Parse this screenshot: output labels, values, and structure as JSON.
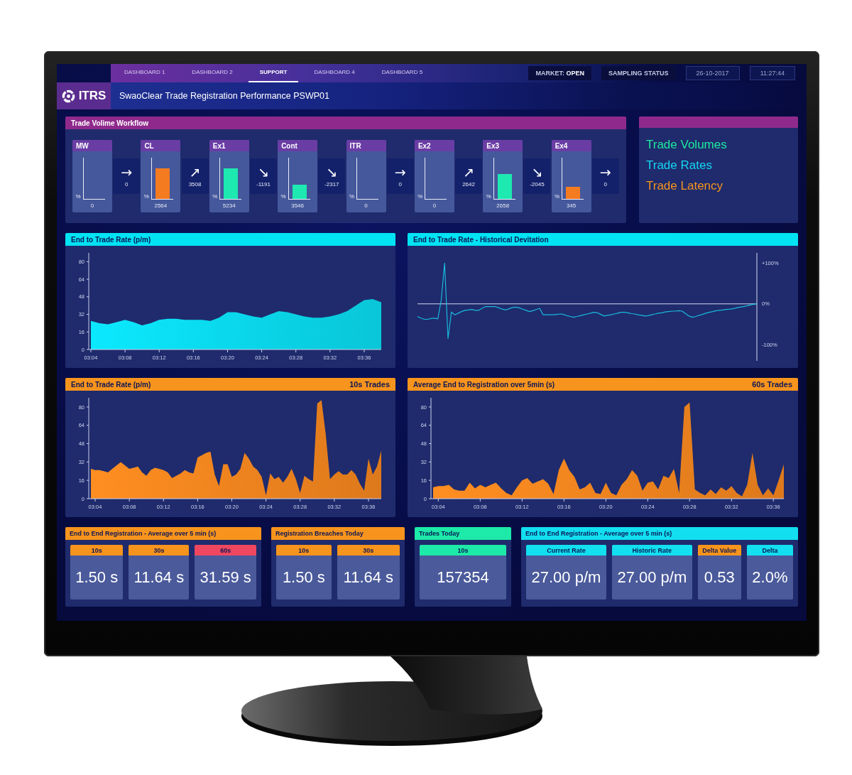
{
  "header": {
    "logo": "ITRS",
    "tabs": [
      {
        "label": "DASHBOARD 1",
        "selected": false
      },
      {
        "label": "DASHBOARD 2",
        "selected": false
      },
      {
        "label": "SUPPORT",
        "selected": true
      },
      {
        "label": "DASHBOARD 4",
        "selected": false
      },
      {
        "label": "DASHBOARD 5",
        "selected": false
      }
    ],
    "title": "SwaoClear Trade Registration Performance PSWP01",
    "status": [
      {
        "kind": "status",
        "text": "MARKET: **OPEN**"
      },
      {
        "kind": "status",
        "text": "SAMPLING STATUS"
      },
      {
        "kind": "readout",
        "text": "26-10-2017"
      },
      {
        "kind": "readout",
        "text": "11:27:44"
      }
    ]
  },
  "workflow": {
    "title": "Trade Volime Workflow",
    "items": [
      {
        "kind": "stage",
        "name": "MW",
        "axis_label": "%",
        "value": "0"
      },
      {
        "kind": "flow",
        "arrow": "→",
        "value": "0"
      },
      {
        "kind": "stage",
        "name": "CL",
        "axis_label": "%",
        "level": 0.75,
        "color": "#f47b20",
        "value": "2564"
      },
      {
        "kind": "flow",
        "arrow": "↗",
        "value": "3508"
      },
      {
        "kind": "stage",
        "name": "Ex1",
        "axis_label": "%",
        "level": 0.75,
        "color": "#1de9b0",
        "value": "5234"
      },
      {
        "kind": "flow",
        "arrow": "↘",
        "value": "-1191"
      },
      {
        "kind": "stage",
        "name": "Cont",
        "axis_label": "%",
        "level": 0.35,
        "color": "#1de9b0",
        "value": "3546"
      },
      {
        "kind": "flow",
        "arrow": "↘",
        "value": "-2317"
      },
      {
        "kind": "stage",
        "name": "ITR",
        "axis_label": "%",
        "value": "0"
      },
      {
        "kind": "flow",
        "arrow": "→",
        "value": "0"
      },
      {
        "kind": "stage",
        "name": "Ex2",
        "axis_label": "%",
        "value": "0"
      },
      {
        "kind": "flow",
        "arrow": "↗",
        "value": "2642"
      },
      {
        "kind": "stage",
        "name": "Ex3",
        "axis_label": "%",
        "level": 0.6,
        "color": "#1de9b0",
        "value": "2658"
      },
      {
        "kind": "flow",
        "arrow": "↘",
        "value": "-2045"
      },
      {
        "kind": "stage",
        "name": "Ex4",
        "axis_label": "%",
        "level": 0.3,
        "color": "#f47b20",
        "value": "345"
      },
      {
        "kind": "flow",
        "arrow": "→",
        "value": "0"
      }
    ]
  },
  "legend": {
    "items": [
      {
        "label": "Trade Volumes",
        "color": "#1de9a0"
      },
      {
        "label": "Trade Rates",
        "color": "#16d6f2"
      },
      {
        "label": "Trade Latency",
        "color": "#f7941d"
      }
    ]
  },
  "charts": [
    {
      "title": "End to Trade Rate (p/m)",
      "color": "#00e3f3",
      "chart_data": {
        "type": "area",
        "categories": [
          "03:04",
          null,
          null,
          null,
          "03:08",
          null,
          null,
          null,
          "03:12",
          null,
          null,
          null,
          "03:16",
          null,
          null,
          null,
          "03:20",
          null,
          null,
          null,
          "03:24",
          null,
          null,
          null,
          "03:28",
          null,
          null,
          null,
          "03:32",
          null,
          null,
          null,
          "03:36",
          null,
          null
        ],
        "series": [
          {
            "color": "#0adcf0",
            "values": [
              26,
              24,
              23,
              25,
              27,
              25,
              22,
              24,
              27,
              28,
              28,
              27,
              27,
              27,
              26,
              29,
              34,
              34,
              32,
              30,
              29,
              32,
              35,
              34,
              32,
              30,
              29,
              29,
              30,
              32,
              35,
              40,
              45,
              46,
              43
            ]
          }
        ],
        "ylim": [
          0,
          88
        ],
        "yticks": [
          0,
          16,
          32,
          48,
          64,
          80
        ]
      }
    },
    {
      "title": "End to Trade Rate - Historical Devitation",
      "color": "#00e3f3",
      "chart_data": {
        "type": "line",
        "series": [
          {
            "color": "#1ab8dc",
            "values": [
              -31,
              -35,
              -38,
              -38,
              -36,
              -35,
              -37,
              10,
              100,
              -85,
              -20,
              -27,
              -23,
              -19,
              -16,
              -15,
              -14,
              -16,
              -16,
              -11,
              -7,
              -7,
              -7,
              -7,
              -10,
              -13,
              -15,
              -12,
              -9,
              -8,
              -10,
              -13,
              -16,
              -19,
              -17,
              -14,
              -11,
              -27,
              -27,
              -27,
              -27,
              -26,
              -25,
              -26,
              -29,
              -31,
              -33,
              -31,
              -29,
              -27,
              -25,
              -23,
              -21,
              -22,
              -26,
              -30,
              -28,
              -27,
              -25,
              -23,
              -21,
              -21,
              -22,
              -24,
              -25,
              -27,
              -28,
              -30,
              -29,
              -27,
              -25,
              -23,
              -22,
              -20,
              -19,
              -18,
              -18,
              -17,
              -18,
              -24,
              -30,
              -33,
              -31,
              -28,
              -26,
              -23,
              -21,
              -19,
              -17,
              -16,
              -15,
              -14,
              -13,
              -12,
              -10,
              -8,
              -7,
              -5,
              -3,
              -1,
              0
            ]
          }
        ],
        "ylim": [
          -140,
          125
        ],
        "yticks": [
          {
            "value": 100,
            "label": "+100%"
          },
          {
            "value": 0,
            "label": "0%"
          },
          {
            "value": -100,
            "label": "-100%"
          }
        ],
        "ref_lines": [
          {
            "axis": "y",
            "value": 0
          }
        ]
      }
    },
    {
      "title": "End to Trade Rate (p/m)",
      "subtitle": "10s Trades",
      "color": "#f7941d",
      "chart_data": {
        "type": "area",
        "categories": [
          null,
          "03:04",
          null,
          null,
          null,
          null,
          null,
          null,
          null,
          "03:08",
          null,
          null,
          null,
          null,
          null,
          null,
          null,
          "03:12",
          null,
          null,
          null,
          null,
          null,
          null,
          null,
          "03:16",
          null,
          null,
          null,
          null,
          null,
          null,
          null,
          "03:20",
          null,
          null,
          null,
          null,
          null,
          null,
          null,
          "03:24",
          null,
          null,
          null,
          null,
          null,
          null,
          null,
          "03:28",
          null,
          null,
          null,
          null,
          null,
          null,
          null,
          "03:32",
          null,
          null,
          null,
          null,
          null,
          null,
          null,
          "03:36",
          null,
          null,
          null
        ],
        "series": [
          {
            "color": "#f5861f",
            "values": [
              26,
              25,
              25,
              24,
              23,
              26,
              29,
              32,
              29,
              26,
              27,
              28,
              23,
              20,
              25,
              27,
              26,
              25,
              23,
              18,
              20,
              22,
              25,
              23,
              22,
              36,
              38,
              40,
              41,
              21,
              11,
              30,
              30,
              19,
              21,
              26,
              40,
              35,
              28,
              25,
              19,
              3,
              22,
              17,
              19,
              14,
              19,
              26,
              17,
              5,
              20,
              17,
              15,
              83,
              86,
              56,
              17,
              21,
              24,
              21,
              21,
              25,
              21,
              13,
              7,
              35,
              21,
              28,
              42
            ]
          }
        ],
        "ylim": [
          0,
          88
        ],
        "yticks": [
          0,
          16,
          32,
          48,
          64,
          80
        ]
      }
    },
    {
      "title": "Average End to Registration over 5min (s)",
      "subtitle": "60s Trades",
      "color": "#f7941d",
      "chart_data": {
        "type": "area",
        "categories": [
          null,
          "03:04",
          null,
          null,
          null,
          null,
          null,
          null,
          null,
          "03:08",
          null,
          null,
          null,
          null,
          null,
          null,
          null,
          "03:12",
          null,
          null,
          null,
          null,
          null,
          null,
          null,
          "03:16",
          null,
          null,
          null,
          null,
          null,
          null,
          null,
          "03:20",
          null,
          null,
          null,
          null,
          null,
          null,
          null,
          "03:24",
          null,
          null,
          null,
          null,
          null,
          null,
          null,
          "03:28",
          null,
          null,
          null,
          null,
          null,
          null,
          null,
          "03:32",
          null,
          null,
          null,
          null,
          null,
          null,
          null,
          "03:36",
          null,
          null
        ],
        "series": [
          {
            "color": "#f5861f",
            "values": [
              10,
              11,
              11,
              12,
              8,
              7,
              7,
              14,
              9,
              12,
              10,
              12,
              14,
              9,
              5,
              3,
              10,
              16,
              18,
              13,
              15,
              17,
              13,
              4,
              25,
              35,
              25,
              19,
              8,
              10,
              14,
              5,
              4,
              14,
              5,
              3,
              12,
              17,
              25,
              20,
              7,
              14,
              15,
              8,
              20,
              18,
              26,
              5,
              80,
              84,
              8,
              5,
              3,
              8,
              4,
              10,
              7,
              11,
              5,
              2,
              12,
              40,
              12,
              3,
              9,
              3,
              16,
              30
            ]
          }
        ],
        "ylim": [
          0,
          88
        ],
        "yticks": [
          0,
          16,
          32,
          48,
          64,
          80
        ]
      }
    }
  ],
  "stats": [
    {
      "title": "End to End Registration - Average over 5 min (s)",
      "color": "#f7941d",
      "tiles": [
        {
          "label": "10s",
          "color": "#f7941d",
          "value": "1.50 s"
        },
        {
          "label": "30s",
          "color": "#f7941d",
          "value": "11.64 s"
        },
        {
          "label": "60s",
          "color": "#ef4760",
          "value": "31.59 s"
        }
      ]
    },
    {
      "title": "Registration Breaches Today",
      "color": "#f7941d",
      "tiles": [
        {
          "label": "10s",
          "color": "#f7941d",
          "value": "1.50 s"
        },
        {
          "label": "30s",
          "color": "#f7941d",
          "value": "11.64 s"
        }
      ]
    },
    {
      "title": "Trades Today",
      "color": "#1de9a8",
      "tiles": [
        {
          "label": "10s",
          "color": "#1de9a8",
          "value": "157354"
        }
      ]
    },
    {
      "title": "End to End Registration - Average over 5 min (s)",
      "color": "#12dff0",
      "tiles": [
        {
          "label": "Current Rate",
          "color": "#12dff0",
          "value": "27.00 p/m"
        },
        {
          "label": "Historic Rate",
          "color": "#12dff0",
          "value": "27.00 p/m"
        },
        {
          "label": "Delta Value",
          "color": "#f7941d",
          "value": "0.53"
        },
        {
          "label": "Delta",
          "color": "#12dff0",
          "value": "2.0%"
        }
      ]
    }
  ]
}
